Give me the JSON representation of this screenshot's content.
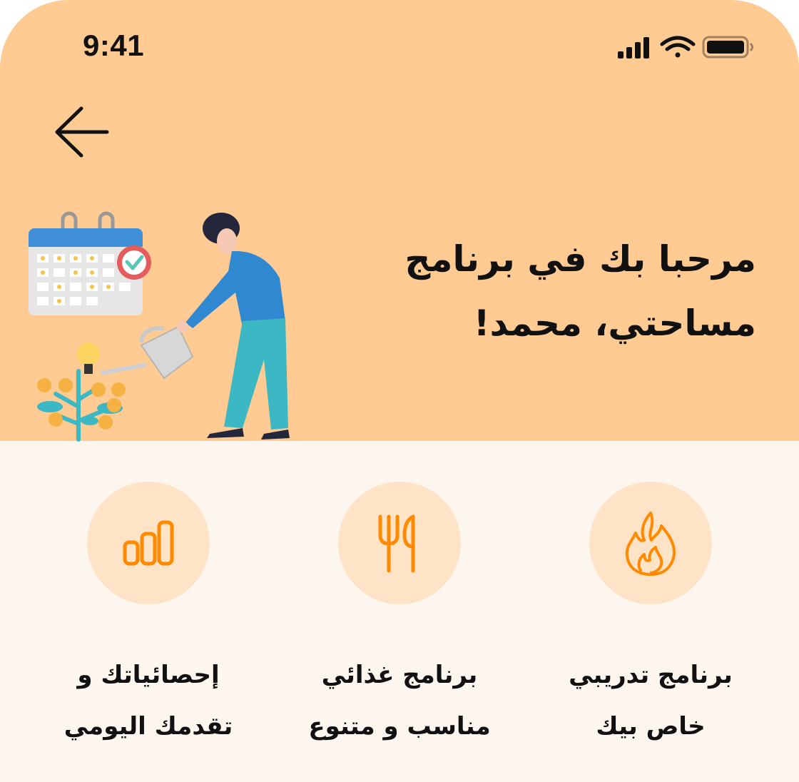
{
  "status_bar": {
    "time": "9:41",
    "icons": [
      "cellular-signal-icon",
      "wifi-icon",
      "battery-icon"
    ]
  },
  "header": {
    "back_icon": "arrow-left-icon",
    "welcome_line1": "مرحبا بك في برنامج",
    "welcome_line2": "مساحتي، محمد!"
  },
  "illustration": {
    "description_icon": "person-watering-money-plant-illustration"
  },
  "features": [
    {
      "icon": "flame-icon",
      "line1": "برنامج تدريبي",
      "line2": "خاص بيك"
    },
    {
      "icon": "fork-knife-icon",
      "line1": "برنامج غذائي",
      "line2": "مناسب و متنوع"
    },
    {
      "icon": "bar-chart-icon",
      "line1": "إحصائياتك و",
      "line2": "تقدمك اليومي"
    }
  ],
  "colors": {
    "hero_bg": "#ffcb93",
    "page_bg": "#fcf6ef",
    "icon_circle": "#ffe3c6",
    "accent": "#ff8a00",
    "text": "#111111"
  }
}
